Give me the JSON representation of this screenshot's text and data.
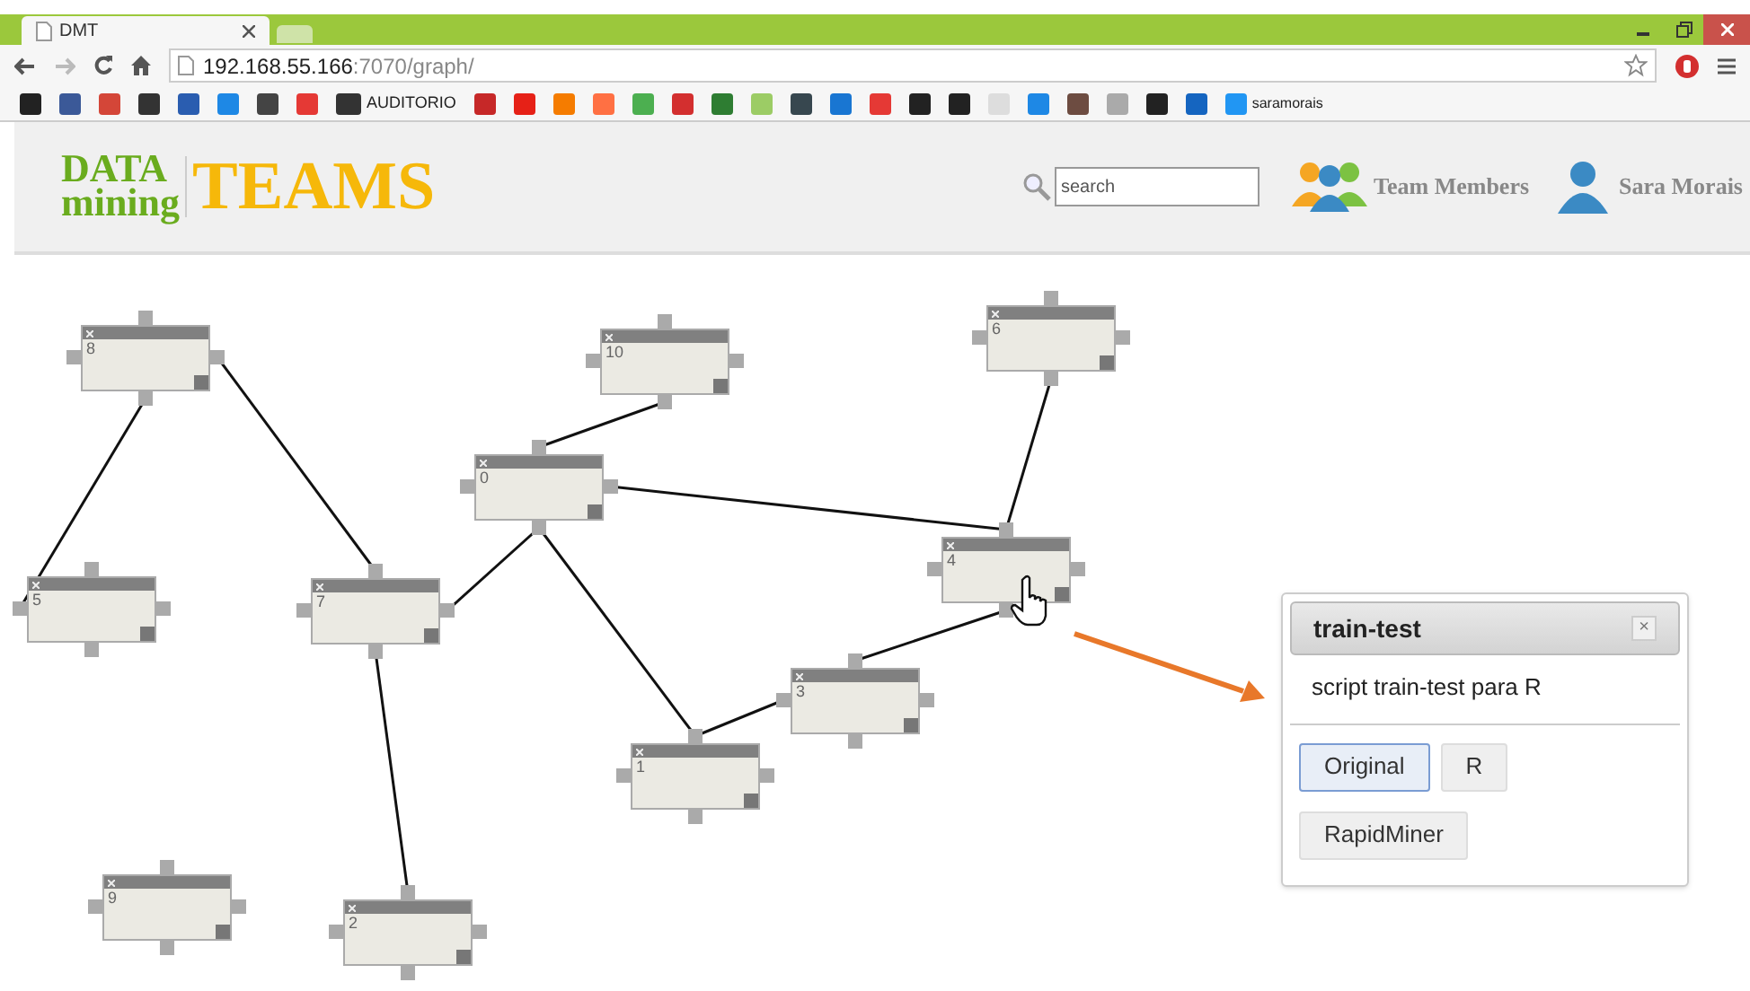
{
  "browser": {
    "tab": {
      "title": "DMT"
    },
    "address": {
      "host": "192.168.55.166",
      "rest": ":7070/graph/"
    },
    "bookmarks": [
      {
        "label": "AUDITORIO"
      },
      {
        "label": "saramorais"
      }
    ]
  },
  "header": {
    "logo": {
      "top": "DATA",
      "bottom": "mining",
      "main": "TEAMS"
    },
    "search": {
      "placeholder": "search"
    },
    "links": [
      "Team Members",
      "Sara Morais"
    ]
  },
  "nodes": [
    {
      "label": "8"
    },
    {
      "label": "10"
    },
    {
      "label": "6"
    },
    {
      "label": "0"
    },
    {
      "label": "4"
    },
    {
      "label": "5"
    },
    {
      "label": "7"
    },
    {
      "label": "3"
    },
    {
      "label": "1"
    },
    {
      "label": "9"
    },
    {
      "label": "2"
    }
  ],
  "popup": {
    "title": "train-test",
    "close": "×",
    "description": "script train-test para R",
    "buttons": [
      {
        "label": "Original",
        "selected": true
      },
      {
        "label": "R",
        "selected": false
      },
      {
        "label": "RapidMiner",
        "selected": false
      }
    ]
  }
}
